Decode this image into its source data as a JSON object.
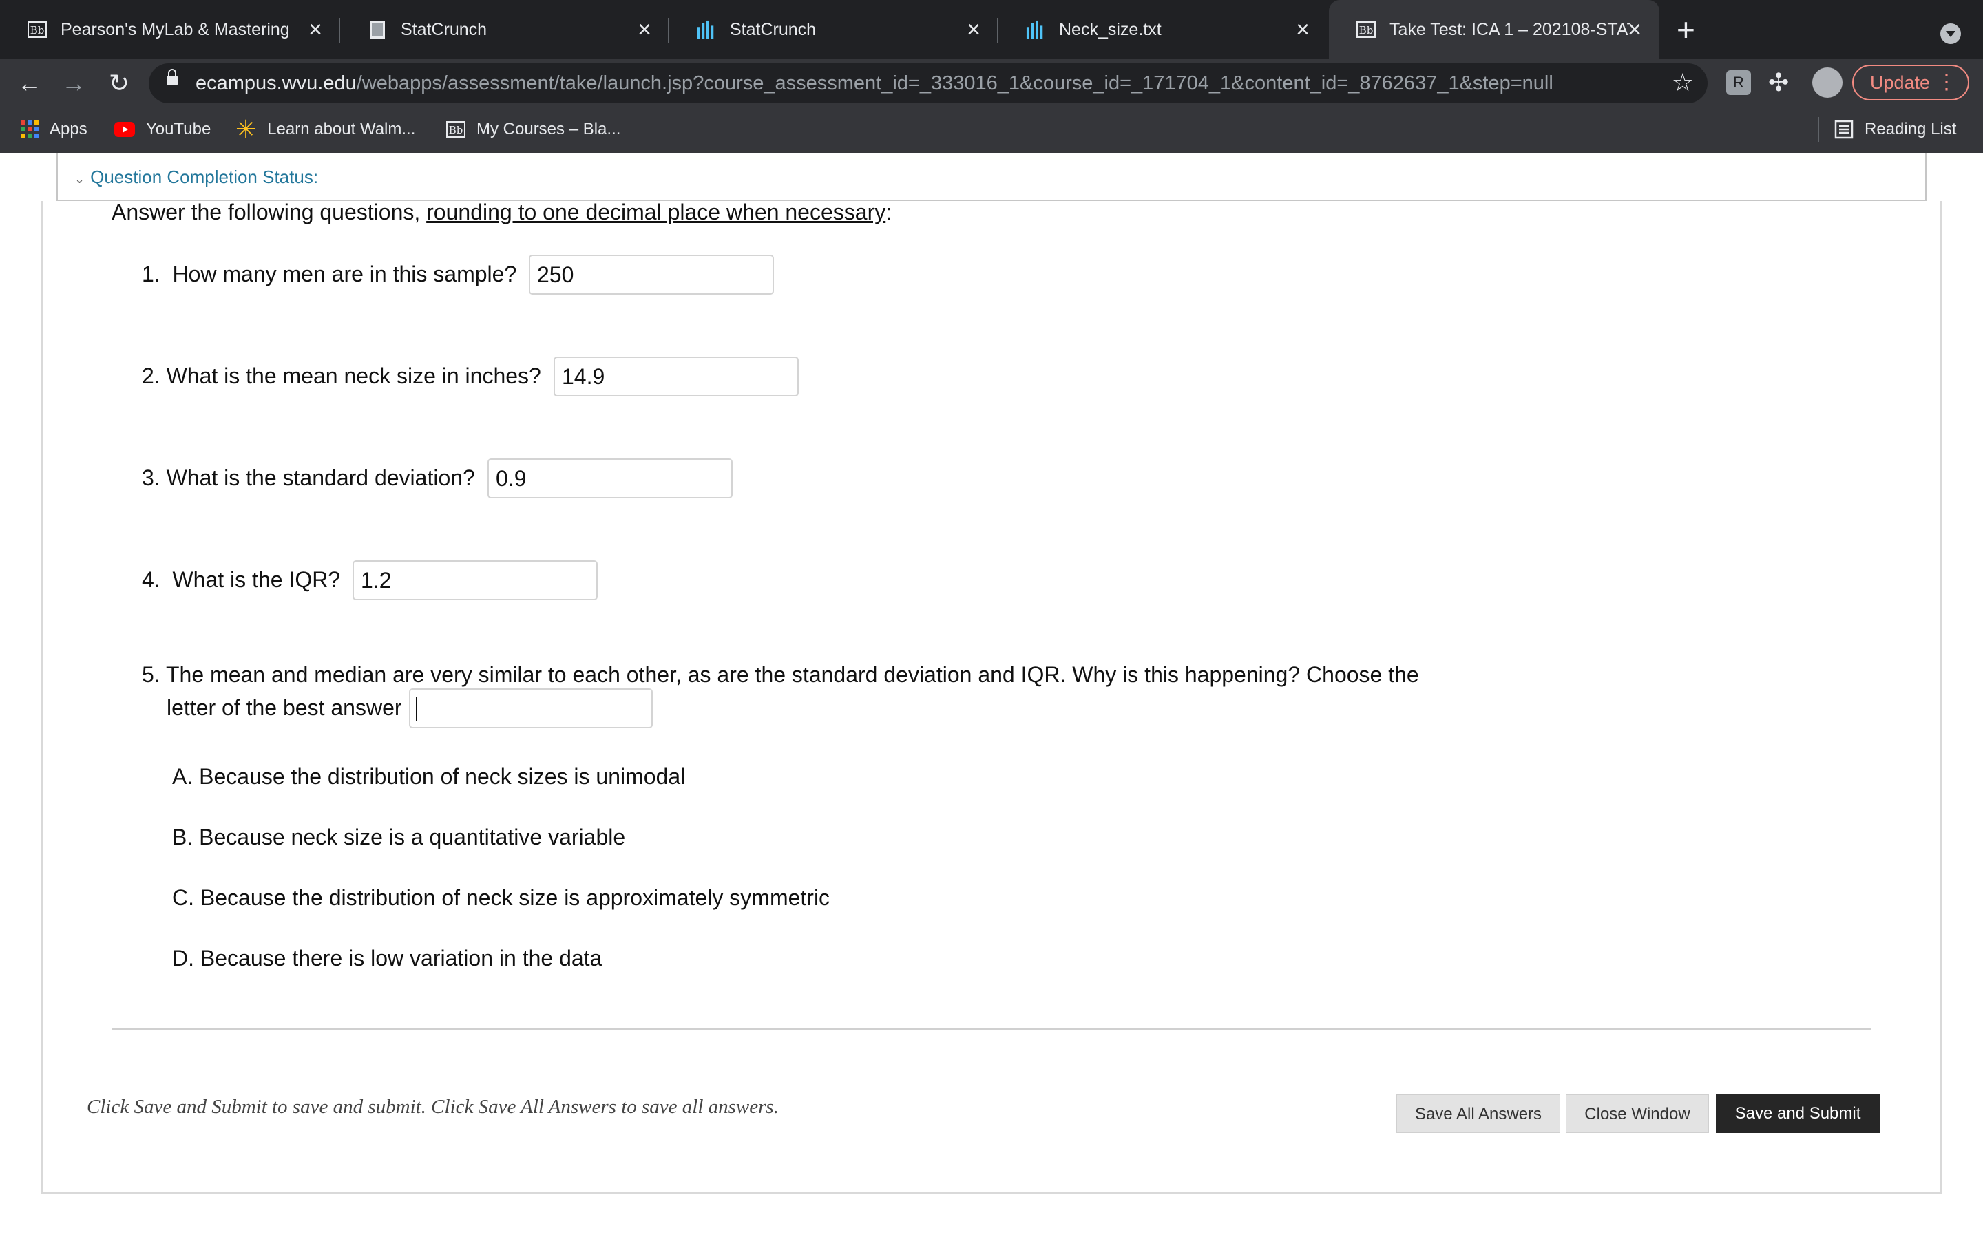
{
  "browser": {
    "tabs": [
      {
        "title": "Pearson's MyLab & Mastering",
        "favicon": "blackboard-icon",
        "active": false
      },
      {
        "title": "StatCrunch",
        "favicon": "document-icon",
        "active": false
      },
      {
        "title": "StatCrunch",
        "favicon": "statcrunch-bars-icon",
        "active": false
      },
      {
        "title": "Neck_size.txt",
        "favicon": "statcrunch-bars-icon",
        "active": false
      },
      {
        "title": "Take Test: ICA 1 – 202108-STAT",
        "favicon": "blackboard-icon",
        "active": true
      }
    ],
    "url_host": "ecampus.wvu.edu",
    "url_path": "/webapps/assessment/take/launch.jsp?course_assessment_id=_333016_1&course_id=_171704_1&content_id=_8762637_1&step=null",
    "update_label": "Update",
    "bookmarks": [
      {
        "label": "Apps",
        "icon": "apps-grid-icon"
      },
      {
        "label": "YouTube",
        "icon": "youtube-icon"
      },
      {
        "label": "Learn about Walm...",
        "icon": "walmart-spark-icon"
      },
      {
        "label": "My Courses – Bla...",
        "icon": "blackboard-icon"
      }
    ],
    "reading_list_label": "Reading List",
    "colors": {
      "chrome_dark": "#202124",
      "chrome_toolbar": "#35363a",
      "update_accent": "#f28b82"
    }
  },
  "test": {
    "completion_status_label": "Question Completion Status:",
    "instruction_prefix": "Answer the following questions, ",
    "instruction_underlined": "rounding to one decimal place when necessary",
    "instruction_suffix": ":",
    "questions": [
      {
        "number": "1.",
        "text": "How many men are in this sample?",
        "answer": "250"
      },
      {
        "number": "2.",
        "text": "What is the mean neck size in inches?",
        "answer": "14.9"
      },
      {
        "number": "3.",
        "text": "What is the standard deviation?",
        "answer": "0.9"
      },
      {
        "number": "4.",
        "text": "What is the IQR?",
        "answer": "1.2"
      }
    ],
    "q5": {
      "line1": "5. The mean and median are very similar to each other, as are the standard deviation and IQR.  Why is this happening?  Choose the",
      "line2": "letter of the best answer",
      "answer": ""
    },
    "options": [
      "A. Because the distribution of neck sizes is unimodal",
      "B. Because neck size is a quantitative variable",
      "C. Because the distribution of neck size is approximately symmetric",
      "D. Because there is low variation in the data"
    ],
    "footer_note": "Click Save and Submit to save and submit. Click Save All Answers to save all answers.",
    "buttons": {
      "save_all": "Save All Answers",
      "close_window": "Close Window",
      "save_submit": "Save and Submit"
    },
    "colors": {
      "link": "#23779b",
      "primary_button": "#262626",
      "secondary_button": "#e3e3e3"
    }
  }
}
